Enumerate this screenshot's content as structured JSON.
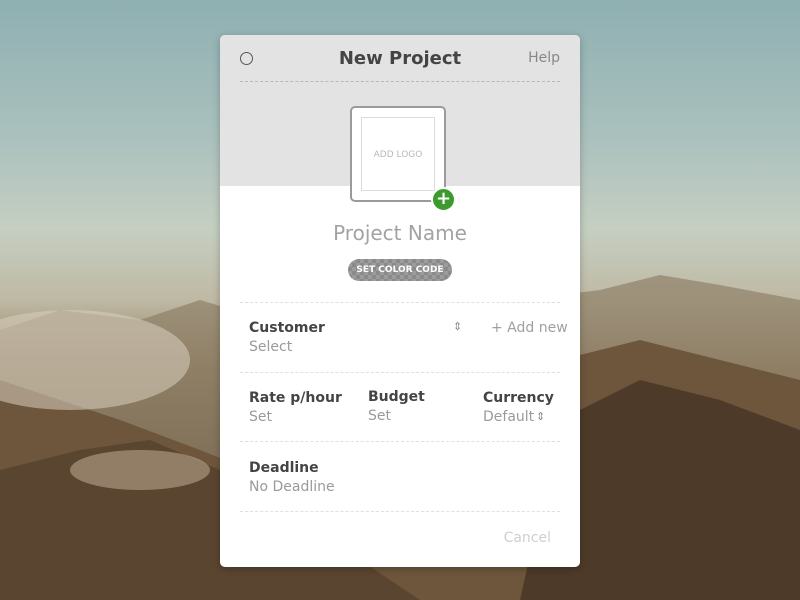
{
  "background": {
    "description_colors": {
      "sky": "#9db7b6",
      "ground": "#6a543b"
    }
  },
  "modal": {
    "title": "New Project",
    "help_label": "Help",
    "logo_placeholder": "ADD LOGO",
    "add_logo_plus": "+",
    "project_name_placeholder": "Project Name",
    "color_code_label": "SET COLOR CODE",
    "customer": {
      "label": "Customer",
      "value": "Select",
      "add_new": "+ Add new"
    },
    "rate": {
      "label": "Rate p/hour",
      "value": "Set"
    },
    "budget": {
      "label": "Budget",
      "value": "Set"
    },
    "currency": {
      "label": "Currency",
      "value": "Default"
    },
    "deadline": {
      "label": "Deadline",
      "value": "No Deadline"
    },
    "cancel_label": "Cancel",
    "accent_color": "#3d9a2f"
  }
}
